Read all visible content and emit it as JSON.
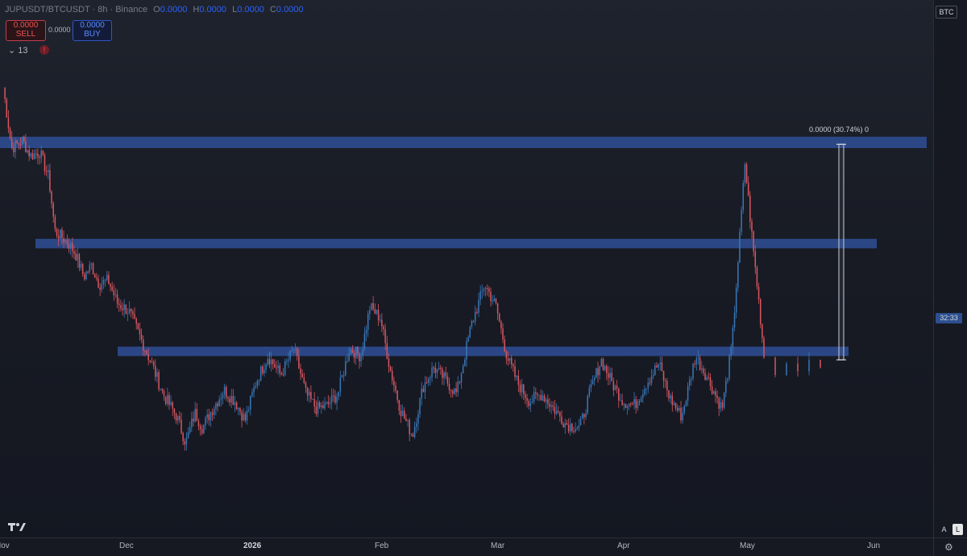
{
  "legend": {
    "symbol": "JUPUSDT/BTCUSDT · 8h · Binance",
    "open_key": "O",
    "open": "0.0000",
    "high_key": "H",
    "high": "0.0000",
    "low_key": "L",
    "low": "0.0000",
    "close_key": "C",
    "close": "0.0000"
  },
  "trade": {
    "sell_price": "0.0000",
    "sell_label": "SELL",
    "spread": "0.0000",
    "buy_price": "0.0000",
    "buy_label": "BUY"
  },
  "indicators": {
    "count": "13",
    "alert_icon": "!"
  },
  "price_scale": {
    "currency": "BTC",
    "countdown": "32:33"
  },
  "measure": {
    "label": "0.0000 (30.74%) 0"
  },
  "bottom": {
    "auto_label": "A",
    "log_label": "L"
  },
  "colors": {
    "up": "#3a77b8",
    "down": "#d9565f",
    "zone": "#2f4f96",
    "background": "#1b1e27"
  },
  "chart_data": {
    "type": "candlestick",
    "timeframe": "8h",
    "x_ticks": [
      "Nov",
      "Dec",
      "2026",
      "Feb",
      "Mar",
      "Apr",
      "May",
      "Jun"
    ],
    "x_range": [
      "Nov",
      "Jun"
    ],
    "y_axis_unit": "BTC",
    "price_series_relative": [
      {
        "t": 0.0,
        "p": 0.96
      },
      {
        "t": 0.011,
        "p": 0.8
      },
      {
        "t": 0.025,
        "p": 0.82
      },
      {
        "t": 0.036,
        "p": 0.78
      },
      {
        "t": 0.048,
        "p": 0.79
      },
      {
        "t": 0.06,
        "p": 0.72
      },
      {
        "t": 0.068,
        "p": 0.58
      },
      {
        "t": 0.085,
        "p": 0.55
      },
      {
        "t": 0.095,
        "p": 0.52
      },
      {
        "t": 0.106,
        "p": 0.46
      },
      {
        "t": 0.116,
        "p": 0.49
      },
      {
        "t": 0.126,
        "p": 0.44
      },
      {
        "t": 0.138,
        "p": 0.45
      },
      {
        "t": 0.15,
        "p": 0.39
      },
      {
        "t": 0.165,
        "p": 0.37
      },
      {
        "t": 0.18,
        "p": 0.3
      },
      {
        "t": 0.195,
        "p": 0.23
      },
      {
        "t": 0.21,
        "p": 0.15
      },
      {
        "t": 0.228,
        "p": 0.09
      },
      {
        "t": 0.24,
        "p": 0.02
      },
      {
        "t": 0.252,
        "p": 0.1
      },
      {
        "t": 0.262,
        "p": 0.06
      },
      {
        "t": 0.275,
        "p": 0.11
      },
      {
        "t": 0.29,
        "p": 0.16
      },
      {
        "t": 0.305,
        "p": 0.13
      },
      {
        "t": 0.318,
        "p": 0.08
      },
      {
        "t": 0.332,
        "p": 0.18
      },
      {
        "t": 0.348,
        "p": 0.25
      },
      {
        "t": 0.365,
        "p": 0.2
      },
      {
        "t": 0.382,
        "p": 0.27
      },
      {
        "t": 0.398,
        "p": 0.15
      },
      {
        "t": 0.412,
        "p": 0.11
      },
      {
        "t": 0.426,
        "p": 0.12
      },
      {
        "t": 0.44,
        "p": 0.15
      },
      {
        "t": 0.455,
        "p": 0.27
      },
      {
        "t": 0.47,
        "p": 0.25
      },
      {
        "t": 0.482,
        "p": 0.38
      },
      {
        "t": 0.496,
        "p": 0.35
      },
      {
        "t": 0.508,
        "p": 0.22
      },
      {
        "t": 0.522,
        "p": 0.11
      },
      {
        "t": 0.538,
        "p": 0.04
      },
      {
        "t": 0.552,
        "p": 0.17
      },
      {
        "t": 0.566,
        "p": 0.22
      },
      {
        "t": 0.58,
        "p": 0.19
      },
      {
        "t": 0.596,
        "p": 0.15
      },
      {
        "t": 0.615,
        "p": 0.33
      },
      {
        "t": 0.633,
        "p": 0.44
      },
      {
        "t": 0.648,
        "p": 0.38
      },
      {
        "t": 0.662,
        "p": 0.25
      },
      {
        "t": 0.676,
        "p": 0.18
      },
      {
        "t": 0.692,
        "p": 0.13
      },
      {
        "t": 0.708,
        "p": 0.15
      },
      {
        "t": 0.724,
        "p": 0.11
      },
      {
        "t": 0.74,
        "p": 0.07
      },
      {
        "t": 0.758,
        "p": 0.06
      },
      {
        "t": 0.772,
        "p": 0.16
      },
      {
        "t": 0.786,
        "p": 0.24
      },
      {
        "t": 0.8,
        "p": 0.18
      },
      {
        "t": 0.815,
        "p": 0.13
      },
      {
        "t": 0.83,
        "p": 0.12
      },
      {
        "t": 0.846,
        "p": 0.18
      },
      {
        "t": 0.862,
        "p": 0.23
      },
      {
        "t": 0.876,
        "p": 0.14
      },
      {
        "t": 0.892,
        "p": 0.09
      },
      {
        "t": 0.91,
        "p": 0.25
      },
      {
        "t": 0.924,
        "p": 0.2
      },
      {
        "t": 0.945,
        "p": 0.11
      },
      {
        "t": 0.958,
        "p": 0.28
      },
      {
        "t": 0.968,
        "p": 0.56
      },
      {
        "t": 0.975,
        "p": 0.76
      },
      {
        "t": 0.985,
        "p": 0.55
      },
      {
        "t": 0.994,
        "p": 0.38
      },
      {
        "t": 1.0,
        "p": 0.25
      }
    ],
    "extra_tail": [
      {
        "p": 0.2
      },
      {
        "p": 0.23
      },
      {
        "p": 0.21
      },
      {
        "p": 0.24
      },
      {
        "p": 0.22
      }
    ],
    "zones": [
      {
        "name": "resistance",
        "low": 0.8,
        "high": 0.83
      },
      {
        "name": "mid",
        "low": 0.535,
        "high": 0.56
      },
      {
        "name": "support",
        "low": 0.25,
        "high": 0.275
      }
    ],
    "measure": {
      "from": 0.24,
      "to": 0.81,
      "label": "0.0000 (30.74%) 0"
    }
  }
}
